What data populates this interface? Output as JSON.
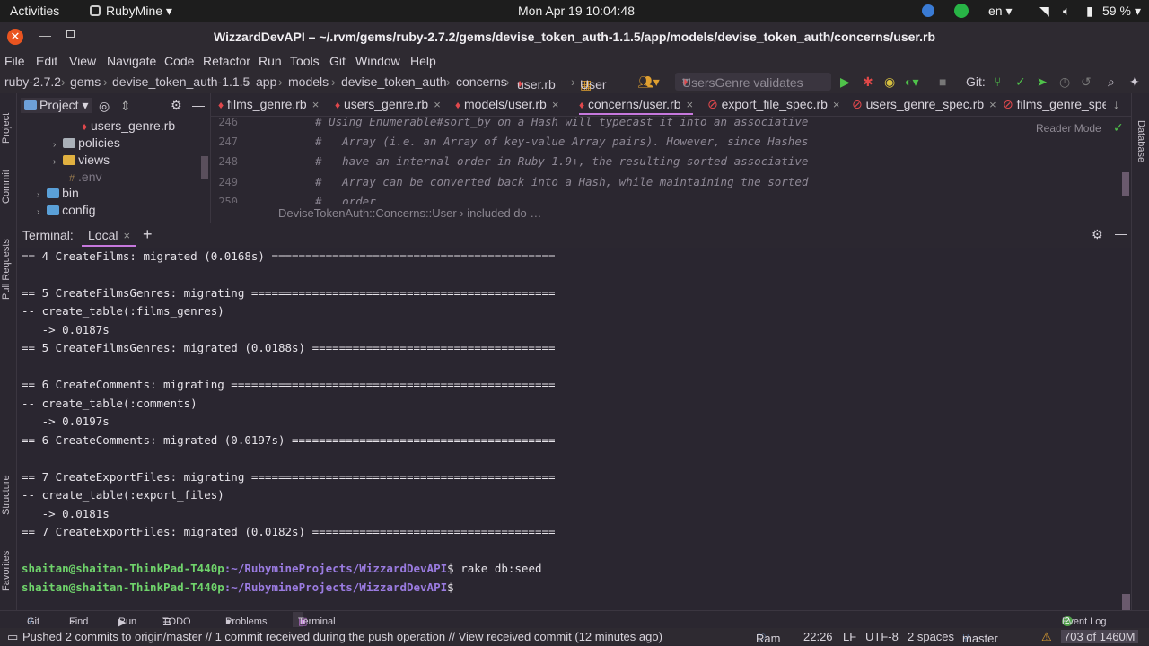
{
  "gnome": {
    "activities": "Activities",
    "app_name": "RubyMine",
    "clock": "Mon Apr 19  10:04:48",
    "lang": "en",
    "battery": "59 %"
  },
  "window": {
    "title": "WizzardDevAPI – ~/.rvm/gems/ruby-2.7.2/gems/devise_token_auth-1.1.5/app/models/devise_token_auth/concerns/user.rb"
  },
  "menu": [
    "File",
    "Edit",
    "View",
    "Navigate",
    "Code",
    "Refactor",
    "Run",
    "Tools",
    "Git",
    "Window",
    "Help"
  ],
  "nav": {
    "crumbs": [
      "ruby-2.7.2",
      "gems",
      "devise_token_auth-1.1.5",
      "app",
      "models",
      "devise_token_auth",
      "concerns",
      "user.rb",
      "User"
    ],
    "run_config": "UsersGenre validates",
    "git_label": "Git:"
  },
  "project": {
    "header": "Project",
    "items": [
      "users_genre.rb",
      "policies",
      "views",
      ".env",
      "bin",
      "config"
    ]
  },
  "tabs": [
    {
      "label": "films_genre.rb"
    },
    {
      "label": "users_genre.rb"
    },
    {
      "label": "models/user.rb"
    },
    {
      "label": "concerns/user.rb"
    },
    {
      "label": "export_file_spec.rb"
    },
    {
      "label": "users_genre_spec.rb"
    },
    {
      "label": "films_genre_spe"
    }
  ],
  "editor": {
    "lines": [
      {
        "num": "246",
        "text": "# Using Enumerable#sort_by on a Hash will typecast it into an associative"
      },
      {
        "num": "247",
        "text": "#   Array (i.e. an Array of key-value Array pairs). However, since Hashes"
      },
      {
        "num": "248",
        "text": "#   have an internal order in Ruby 1.9+, the resulting sorted associative"
      },
      {
        "num": "249",
        "text": "#   Array can be converted back into a Hash, while maintaining the sorted"
      },
      {
        "num": "250",
        "text": "#   order."
      }
    ],
    "reader_mode": "Reader Mode",
    "breadcrumb": "DeviseTokenAuth::Concerns::User  ›  included do …"
  },
  "terminal": {
    "label": "Terminal:",
    "tab": "Local",
    "lines": [
      "== 4 CreateFilms: migrated (0.0168s) ==========================================",
      "",
      "== 5 CreateFilmsGenres: migrating =============================================",
      "-- create_table(:films_genres)",
      "   -> 0.0187s",
      "== 5 CreateFilmsGenres: migrated (0.0188s) ====================================",
      "",
      "== 6 CreateComments: migrating ================================================",
      "-- create_table(:comments)",
      "   -> 0.0197s",
      "== 6 CreateComments: migrated (0.0197s) =======================================",
      "",
      "== 7 CreateExportFiles: migrating =============================================",
      "-- create_table(:export_files)",
      "   -> 0.0181s",
      "== 7 CreateExportFiles: migrated (0.0182s) ====================================",
      ""
    ],
    "prompt_user": "shaitan@shaitan-ThinkPad-T440p",
    "prompt_path": ":~/RubymineProjects/WizzardDevAPI",
    "command1": "$ rake db:seed",
    "command2": "$"
  },
  "left_strip": [
    "Project",
    "Commit",
    "Pull Requests",
    "Structure",
    "Favorites"
  ],
  "right_strip": [
    "Database"
  ],
  "toolwindows": [
    "Git",
    "Find",
    "Run",
    "TODO",
    "Problems",
    "Terminal"
  ],
  "event_log": "Event Log",
  "event_log_count": "2",
  "status": {
    "message": "Pushed 2 commits to origin/master // 1 commit received during the push operation // View received commit (12 minutes ago)",
    "ram": "Ram",
    "position": "22:26",
    "line_sep": "LF",
    "encoding": "UTF-8",
    "indent": "2 spaces",
    "branch": "master",
    "memory": "703 of 1460M"
  },
  "colors": {
    "prompt_user": "#6fd36b",
    "prompt_path": "#9a7be0",
    "ruby_icon": "#e0484c",
    "accent_tab": "#c678dd"
  }
}
